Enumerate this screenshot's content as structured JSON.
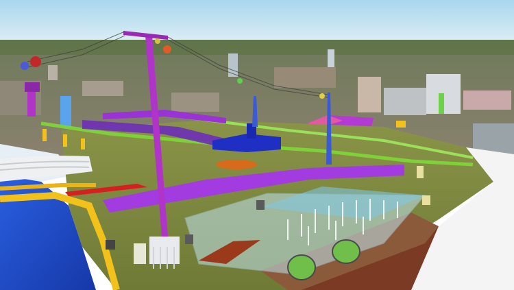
{
  "scene": {
    "kind": "3D BIM infrastructure model overlaid on photogrammetric city mesh",
    "colors": {
      "sky_top": "#a9d6ee",
      "sky_bottom": "#dfeff6",
      "city": "#8a8470",
      "ground_model": "#7e8a3e",
      "water": "#1f4fd1",
      "roadway_purple": "#a23ce0",
      "cable_tower": "#b034c8",
      "yellow_edge": "#f2c21a",
      "green_rail": "#7fd13a",
      "orange_deck": "#d86a1c",
      "translucent_box": "#bfe3ec",
      "soil": "#8a5a3a"
    }
  }
}
